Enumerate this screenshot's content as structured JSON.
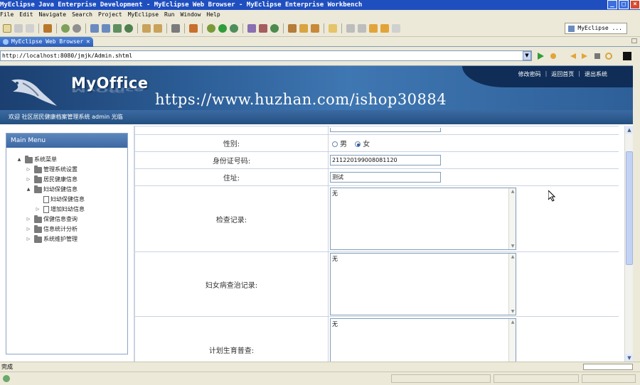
{
  "window": {
    "title": "MyEclipse Java Enterprise Development - MyEclipse Web Browser - MyEclipse Enterprise Workbench"
  },
  "menu": [
    "File",
    "Edit",
    "Navigate",
    "Search",
    "Project",
    "MyEclipse",
    "Run",
    "Window",
    "Help"
  ],
  "perspective": {
    "label": "MyEclipse ..."
  },
  "editor_tab": {
    "label": "MyEclipse Web Browser",
    "close": "✕"
  },
  "browser": {
    "url": "http://localhost:8080/jmjk/Admin.shtml"
  },
  "site": {
    "logo": "MyOffice",
    "links": [
      "修改密码",
      "返回首页",
      "退出系统"
    ],
    "link_sep": "|",
    "watermark": "https://www.huzhan.com/ishop30884",
    "welcome": "欢迎  社区居民健康档案管理系统  admin  光临"
  },
  "sidebar": {
    "title": "Main Menu",
    "tree": [
      {
        "label": "系统菜单",
        "level": 0,
        "toggle": "▲",
        "icon": "folder"
      },
      {
        "label": "管理系统设置",
        "level": 1,
        "toggle": "▷",
        "icon": "folder"
      },
      {
        "label": "居民健康信息",
        "level": 1,
        "toggle": "▷",
        "icon": "folder"
      },
      {
        "label": "妇幼保健信息",
        "level": 1,
        "toggle": "▲",
        "icon": "folder"
      },
      {
        "label": "妇幼保健信息",
        "level": 2,
        "toggle": "",
        "icon": "document"
      },
      {
        "label": "增加妇幼信息",
        "level": 2,
        "toggle": "▷",
        "icon": "document"
      },
      {
        "label": "保健信息查询",
        "level": 1,
        "toggle": "▷",
        "icon": "folder"
      },
      {
        "label": "信息统计分析",
        "level": 1,
        "toggle": "▷",
        "icon": "folder"
      },
      {
        "label": "系统维护管理",
        "level": 1,
        "toggle": "▷",
        "icon": "folder"
      }
    ]
  },
  "form": {
    "gender": {
      "label": "性别:",
      "options": [
        "男",
        "女"
      ],
      "selected": "女"
    },
    "id_number": {
      "label": "身份证号码:",
      "value": "211220199008081120"
    },
    "address": {
      "label": "住址:",
      "value": "测试"
    },
    "exam_record": {
      "label": "检查记录:",
      "value": "无"
    },
    "gyn_record": {
      "label": "妇女病查治记录:",
      "value": "无"
    },
    "family_planning": {
      "label": "计划生育普查:",
      "value": "无"
    }
  },
  "status": {
    "text": "完成"
  },
  "colors": {
    "titlebar": "#1f4fbf",
    "banner": "#2c5d96",
    "sidebar_head": "#4a75b0"
  }
}
